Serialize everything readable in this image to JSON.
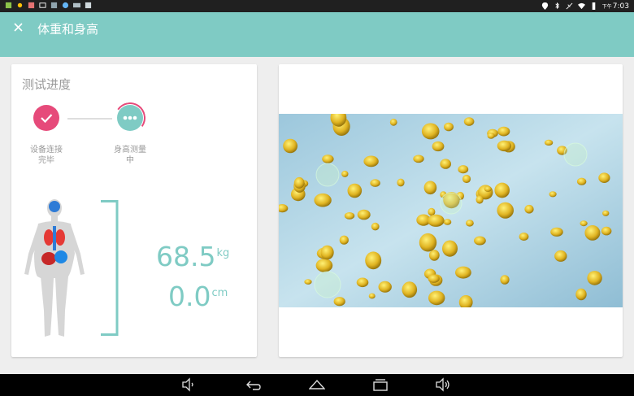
{
  "status_bar": {
    "ampm": "下午",
    "time": "7:03",
    "left_icons": [
      "notification-icon",
      "sun-icon",
      "app-icon",
      "image-icon",
      "app-icon",
      "globe-icon",
      "media-icon",
      "app-icon"
    ],
    "right_icons": [
      "location-icon",
      "bluetooth-icon",
      "no-sound-icon",
      "wifi-icon",
      "battery-icon"
    ]
  },
  "app_bar": {
    "close_icon": "close-icon",
    "title": "体重和身高",
    "color": "#7fcbc4"
  },
  "progress": {
    "title": "测试进度",
    "steps": [
      {
        "label_line1": "设备连接",
        "label_line2": "完毕",
        "state": "completed",
        "icon": "check-icon",
        "color": "#e64a7a"
      },
      {
        "label_line1": "身高测量",
        "label_line2": "中",
        "state": "in-progress",
        "icon": "more-dots-icon",
        "color": "#7fcbc4"
      }
    ]
  },
  "measurements": {
    "weight_value": "68.5",
    "weight_unit": "kg",
    "height_value": "0.0",
    "height_unit": "cm",
    "color": "#7fcbc4"
  },
  "nav_bar": {
    "buttons": [
      "volume-down-icon",
      "back-icon",
      "home-icon",
      "recents-icon",
      "volume-up-icon"
    ]
  }
}
